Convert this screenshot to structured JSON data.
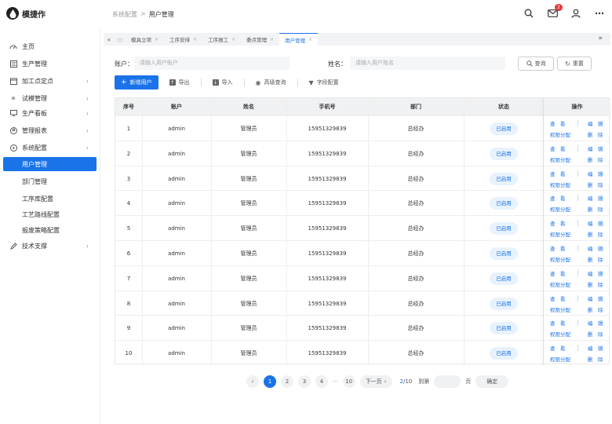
{
  "app": {
    "logo_icon": "droplet-icon",
    "name": "模捷作"
  },
  "breadcrumb": {
    "parent": "系统配置",
    "separator": ">",
    "current": "用户管理"
  },
  "header": {
    "icons": [
      "search-icon",
      "mail-icon",
      "user-icon",
      "more-icon"
    ],
    "mail_badge": "2"
  },
  "colors": {
    "primary": "#1a73e8",
    "badge": "#e53935"
  },
  "sidebar": {
    "items": [
      {
        "label": "主页",
        "icon": "dashboard-icon",
        "chevron": false
      },
      {
        "label": "生产管理",
        "icon": "list-icon",
        "chevron": false
      },
      {
        "label": "加工点定点",
        "icon": "calendar-icon",
        "chevron": true
      },
      {
        "label": "试模管理",
        "icon": "settings-icon",
        "chevron": true
      },
      {
        "label": "生产看板",
        "icon": "monitor-icon",
        "chevron": true
      },
      {
        "label": "管理报表",
        "icon": "report-icon",
        "chevron": true
      },
      {
        "label": "系统配置",
        "icon": "play-icon",
        "chevron": true
      },
      {
        "label": "用户管理",
        "sub": true,
        "active": true
      },
      {
        "label": "部门管理",
        "sub": true
      },
      {
        "label": "工序库配置",
        "sub": true
      },
      {
        "label": "工艺路线配置",
        "sub": true
      },
      {
        "label": "报废策略配置",
        "sub": true
      },
      {
        "label": "技术支撑",
        "icon": "edit-icon",
        "chevron": true
      }
    ]
  },
  "tabs": {
    "nav_left": "«",
    "nav_right": "»",
    "items": [
      {
        "label": "模具立项",
        "active": false
      },
      {
        "label": "工序安排",
        "active": false
      },
      {
        "label": "工序报工",
        "active": false
      },
      {
        "label": "委点管理",
        "active": false
      },
      {
        "label": "用户管理",
        "active": true
      }
    ]
  },
  "filter": {
    "account_label": "账户：",
    "account_placeholder": "请输入用户账户",
    "name_label": "姓名：",
    "name_placeholder": "请输入用户姓名",
    "query_label": "查询",
    "reset_label": "重置"
  },
  "toolbar": {
    "add_label": "新增用户",
    "export_label": "导出",
    "import_label": "导入",
    "advanced_label": "高级查询",
    "fields_label": "字段配置"
  },
  "table": {
    "columns": [
      "序号",
      "账户",
      "姓名",
      "手机号",
      "部门",
      "状态",
      "操作"
    ],
    "rows": [
      {
        "no": "1",
        "account": "admin",
        "name": "管理员",
        "phone": "15951329839",
        "dept": "总经办",
        "status": "已启用"
      },
      {
        "no": "2",
        "account": "admin",
        "name": "管理员",
        "phone": "15951329839",
        "dept": "总经办",
        "status": "已启用"
      },
      {
        "no": "3",
        "account": "admin",
        "name": "管理员",
        "phone": "15951329839",
        "dept": "总经办",
        "status": "已启用"
      },
      {
        "no": "4",
        "account": "admin",
        "name": "管理员",
        "phone": "15951329839",
        "dept": "总经办",
        "status": "已启用"
      },
      {
        "no": "5",
        "account": "admin",
        "name": "管理员",
        "phone": "15951329839",
        "dept": "总经办",
        "status": "已启用"
      },
      {
        "no": "6",
        "account": "admin",
        "name": "管理员",
        "phone": "15951329839",
        "dept": "总经办",
        "status": "已启用"
      },
      {
        "no": "7",
        "account": "admin",
        "name": "管理员",
        "phone": "15951329839",
        "dept": "总经办",
        "status": "已启用"
      },
      {
        "no": "8",
        "account": "admin",
        "name": "管理员",
        "phone": "15951329839",
        "dept": "总经办",
        "status": "已启用"
      },
      {
        "no": "9",
        "account": "admin",
        "name": "管理员",
        "phone": "15951329839",
        "dept": "总经办",
        "status": "已启用"
      },
      {
        "no": "10",
        "account": "admin",
        "name": "管理员",
        "phone": "15951329839",
        "dept": "总经办",
        "status": "已启用"
      }
    ],
    "ops": {
      "view": "查　看",
      "edit": "编　辑",
      "perm": "权限分配",
      "delete": "删　除"
    }
  },
  "pagination": {
    "pages": [
      "1",
      "2",
      "3",
      "4"
    ],
    "ellipsis": "···",
    "last": "10",
    "current": "1",
    "next_label": "下一页",
    "info_current": "2",
    "info_total": "/10",
    "goto_label": "到第",
    "page_unit": "页",
    "confirm_label": "确定"
  }
}
